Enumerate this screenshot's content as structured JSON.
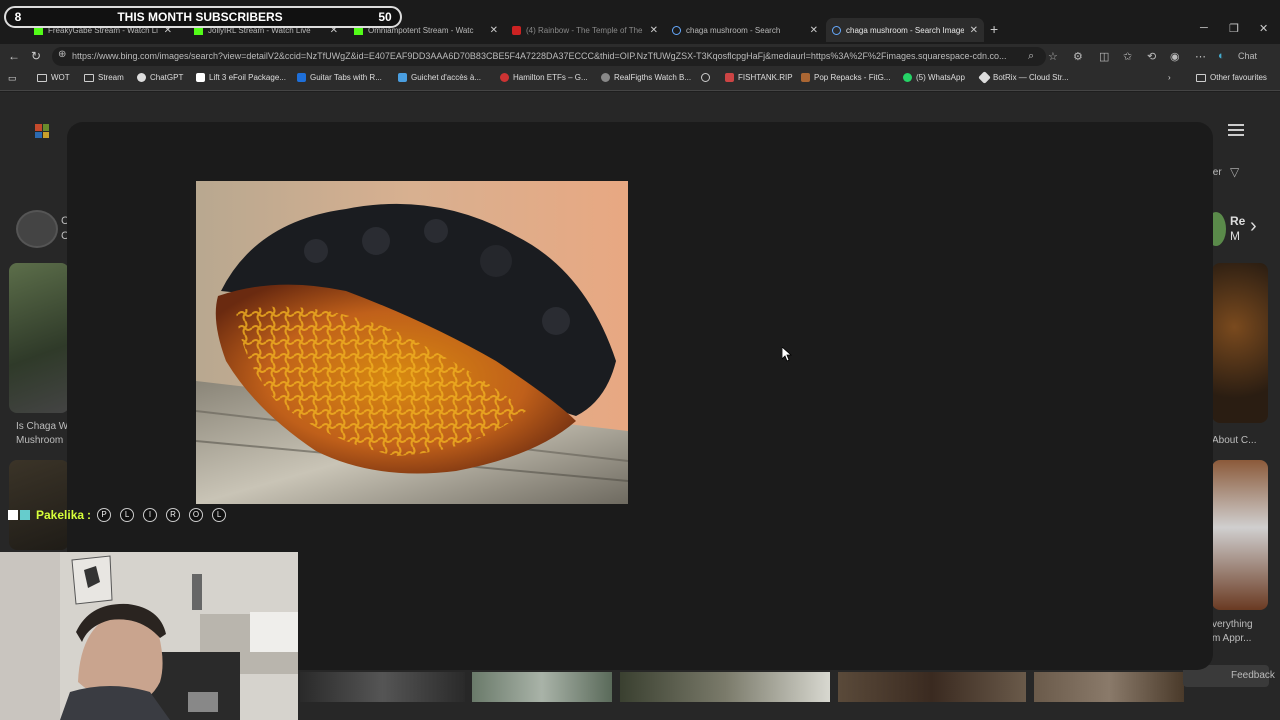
{
  "stream_overlay": {
    "subscriber_count": "8",
    "subscriber_label": "THIS MONTH SUBSCRIBERS",
    "subscriber_goal": "50"
  },
  "browser": {
    "tabs": [
      {
        "title": "FreakyGabe Stream - Watch Live",
        "active": false
      },
      {
        "title": "JollyIRL Stream - Watch Live",
        "active": false
      },
      {
        "title": "Omniampotent Stream - Watc",
        "active": false
      },
      {
        "title": "(4) Rainbow - The Temple of The",
        "active": false
      },
      {
        "title": "chaga mushroom - Search",
        "active": false
      },
      {
        "title": "chaga mushroom - Search Images",
        "active": true
      }
    ],
    "url": "https://www.bing.com/images/search?view=detailV2&ccid=NzTfUWgZ&id=E407EAF9DD3AAA6D70B83CBE5F4A7228DA37ECCC&thid=OIP.NzTfUWgZSX-T3KqosflcpgHaFj&mediaurl=https%3A%2F%2Fimages.squarespace-cdn.co...",
    "chat_button": "Chat",
    "bookmarks": [
      "WOT",
      "Stream",
      "ChatGPT",
      "Lift 3 eFoil Package...",
      "Guitar Tabs with R...",
      "Guichet d'accès à...",
      "Hamilton ETFs – G...",
      "RealFigths Watch B...",
      "",
      "FISHTANK.RIP",
      "Pop Repacks - FitG...",
      "(5) WhatsApp",
      "BotRix — Cloud Str..."
    ],
    "other_favourites": "Other favourites"
  },
  "page": {
    "left_card_caption_1": "Is Chaga W",
    "left_card_caption_2": "Mushroom",
    "right_chip_1": "Re",
    "right_chip_2": "M",
    "right_card_caption_1": "About C...",
    "right_card_caption_2": "verything",
    "right_card_caption_3": "m Appr...",
    "filter_fragment": "ter",
    "left_chip_1": "C",
    "left_chip_2": "C",
    "feedback": "Feedback"
  },
  "chat": {
    "username": "Pakelika",
    "separator": ":",
    "emotes": [
      "P",
      "L",
      "I",
      "R",
      "O",
      "L"
    ]
  },
  "colors": {
    "modal_bg": "#1b1b1b",
    "chat_username": "#d7ff3a"
  }
}
